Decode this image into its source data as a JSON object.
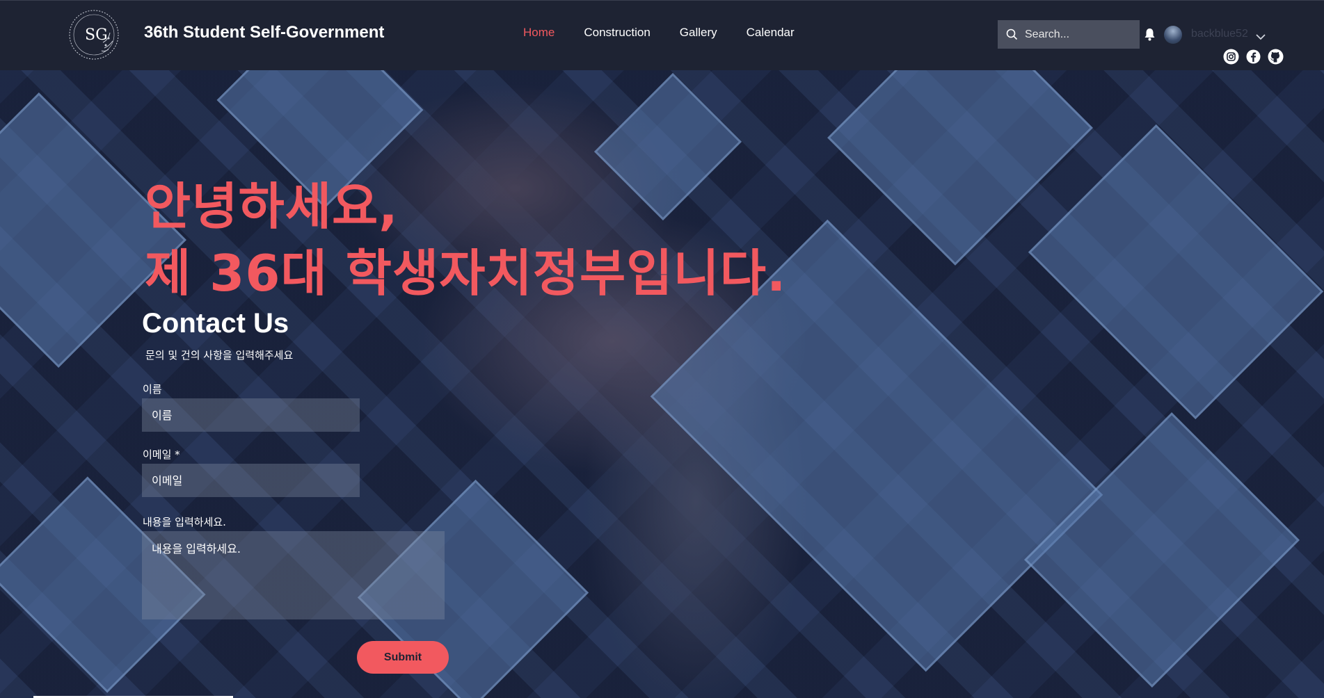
{
  "header": {
    "logo_monogram": "SG",
    "site_title": "36th Student Self-Government",
    "nav": [
      {
        "label": "Home",
        "active": true
      },
      {
        "label": "Construction",
        "active": false
      },
      {
        "label": "Gallery",
        "active": false
      },
      {
        "label": "Calendar",
        "active": false
      }
    ],
    "search_placeholder": "Search...",
    "username": "backblue52",
    "social_icons": [
      "instagram-icon",
      "facebook-icon",
      "github-icon"
    ]
  },
  "hero": {
    "headline_line1": "안녕하세요,",
    "headline_line2": "제 36대 학생자치정부입니다."
  },
  "contact": {
    "title": "Contact Us",
    "subtitle": "문의 및 건의 사항을 입력해주세요",
    "name_label": "이름",
    "name_placeholder": "이름",
    "email_label": "이메일 *",
    "email_placeholder": "이메일",
    "message_label": "내용을 입력하세요.",
    "message_placeholder": "내용을 입력하세요.",
    "submit_label": "Submit"
  },
  "colors": {
    "accent": "#f2595f",
    "header_bg": "#1e2333",
    "search_bg": "#4a4f5e"
  }
}
